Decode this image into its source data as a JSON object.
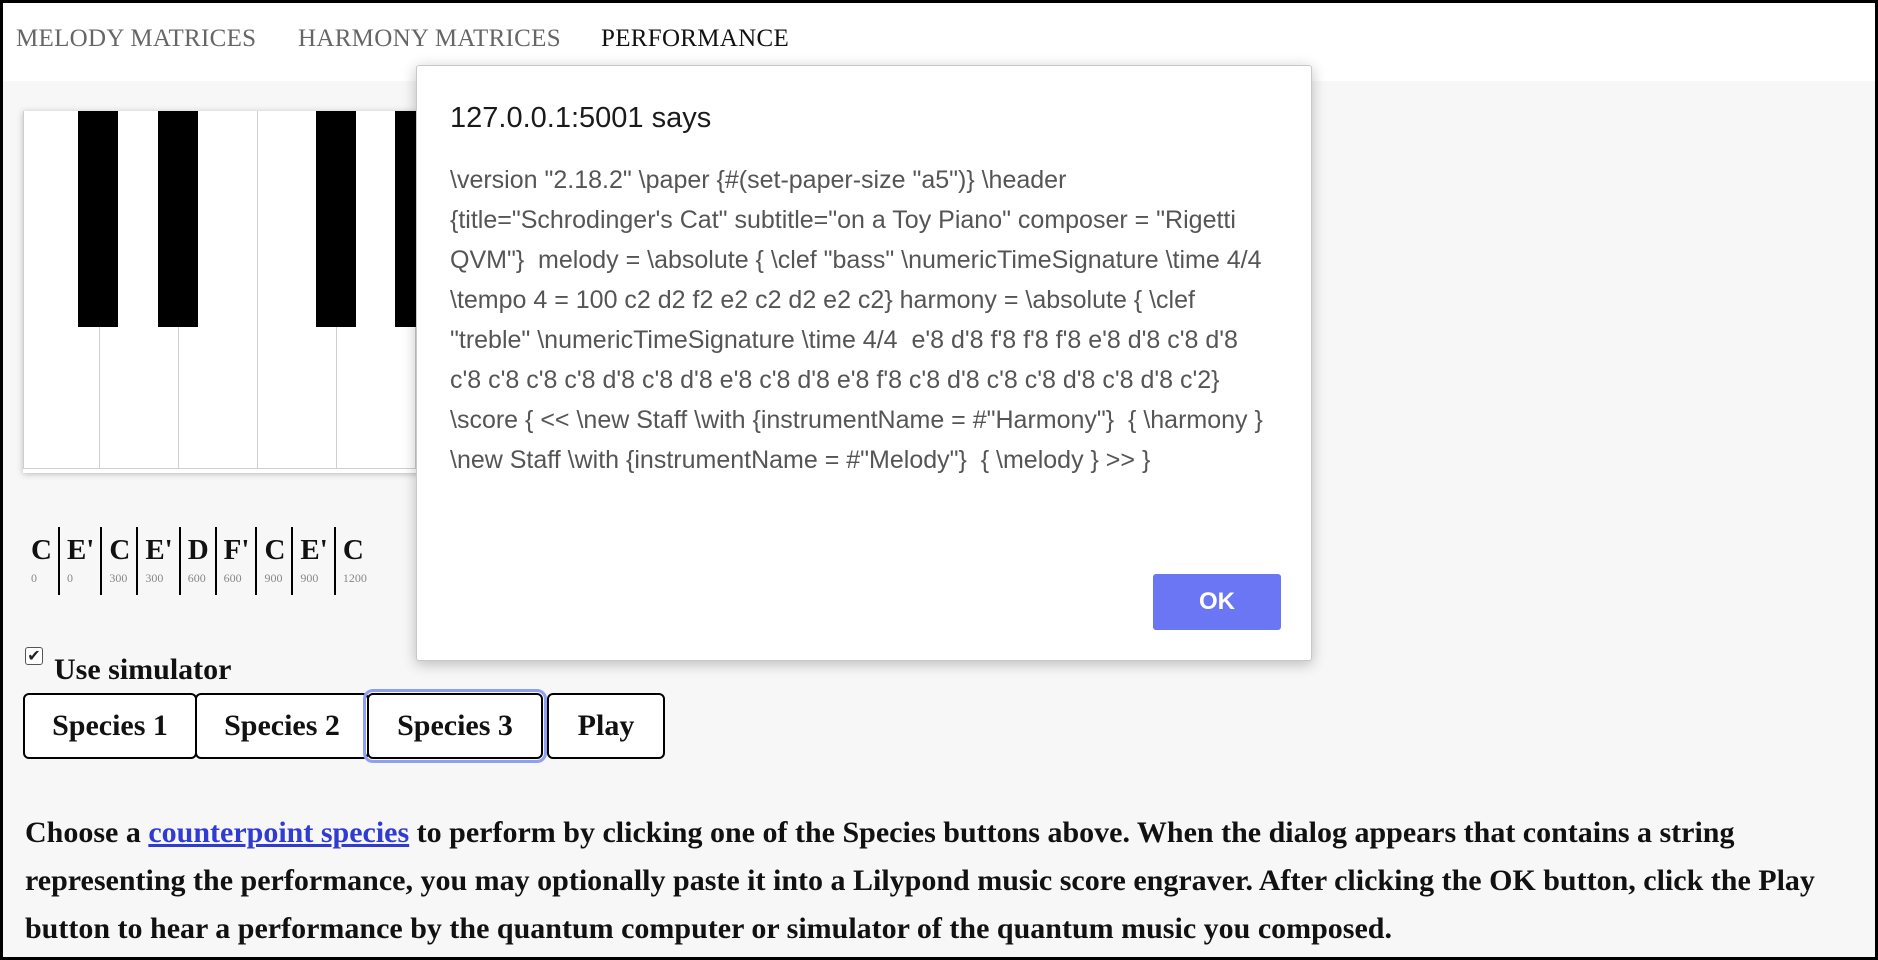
{
  "nav": {
    "items": [
      {
        "label": "MELODY MATRICES"
      },
      {
        "label": "HARMONY MATRICES"
      },
      {
        "label": "PERFORMANCE"
      }
    ]
  },
  "notes": [
    {
      "letter": "C",
      "time": "0"
    },
    {
      "letter": "E'",
      "time": "0"
    },
    {
      "letter": "C",
      "time": "300"
    },
    {
      "letter": "E'",
      "time": "300"
    },
    {
      "letter": "D",
      "time": "600"
    },
    {
      "letter": "F'",
      "time": "600"
    },
    {
      "letter": "C",
      "time": "900"
    },
    {
      "letter": "E'",
      "time": "900"
    },
    {
      "letter": "C",
      "time": "1200"
    }
  ],
  "simulator": {
    "label": "Use simulator",
    "checked": true
  },
  "buttons": {
    "species1": "Species 1",
    "species2": "Species 2",
    "species3": "Species 3",
    "play": "Play"
  },
  "description": {
    "before": "Choose a ",
    "link": "counterpoint species",
    "after": " to perform by clicking one of the Species buttons above. When the dialog appears that contains a string representing the performance, you may optionally paste it into a Lilypond music score engraver. After clicking the OK button, click the Play button to hear a performance by the quantum computer or simulator of the quantum music you composed."
  },
  "dialog": {
    "title": "127.0.0.1:5001 says",
    "message": "\\version \"2.18.2\" \\paper {#(set-paper-size \"a5\")} \\header {title=\"Schrodinger's Cat\" subtitle=\"on a Toy Piano\" composer = \"Rigetti QVM\"}  melody = \\absolute { \\clef \"bass\" \\numericTimeSignature \\time 4/4 \\tempo 4 = 100 c2 d2 f2 e2 c2 d2 e2 c2} harmony = \\absolute { \\clef \"treble\" \\numericTimeSignature \\time 4/4  e'8 d'8 f'8 f'8 f'8 e'8 d'8 c'8 d'8 c'8 c'8 c'8 c'8 d'8 c'8 d'8 e'8 c'8 d'8 e'8 f'8 c'8 d'8 c'8 c'8 d'8 c'8 d'8 c'2} \\score { << \\new Staff \\with {instrumentName = #\"Harmony\"}  { \\harmony } \\new Staff \\with {instrumentName = #\"Melody\"}  { \\melody } >> }",
    "ok_label": "OK"
  }
}
